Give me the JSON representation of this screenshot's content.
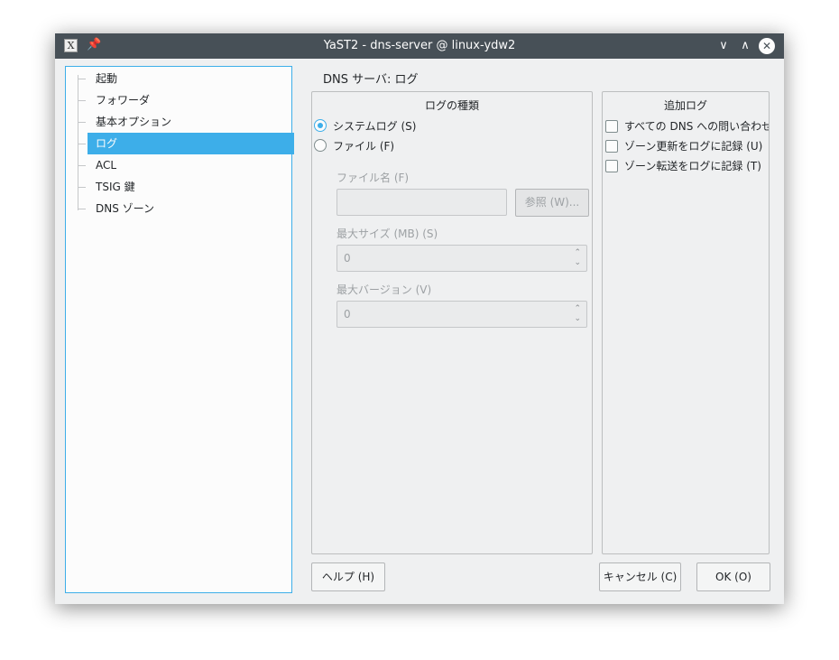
{
  "window": {
    "title": "YaST2 - dns-server @ linux-ydw2",
    "app_icon_glyph": "X",
    "pin_glyph": "📌",
    "min_glyph": "∨",
    "max_glyph": "∧",
    "close_glyph": "✕"
  },
  "tree": {
    "items": [
      {
        "label": "起動"
      },
      {
        "label": "フォワーダ"
      },
      {
        "label": "基本オプション"
      },
      {
        "label": "ログ",
        "selected": true
      },
      {
        "label": "ACL"
      },
      {
        "label": "TSIG 鍵"
      },
      {
        "label": "DNS ゾーン"
      }
    ]
  },
  "main": {
    "section_title": "DNS サーバ: ログ",
    "log_type": {
      "title": "ログの種類",
      "options": [
        {
          "label": "システムログ (S)",
          "checked": true
        },
        {
          "label": "ファイル (F)",
          "checked": false
        }
      ],
      "file_name_label": "ファイル名 (F)",
      "file_name_value": "",
      "browse_label": "参照 (W)...",
      "max_size_label": "最大サイズ (MB) (S)",
      "max_size_value": "0",
      "max_versions_label": "最大バージョン (V)",
      "max_versions_value": "0",
      "spin_up": "⌃",
      "spin_down": "⌄"
    },
    "extra_log": {
      "title": "追加ログ",
      "options": [
        {
          "label": "すべての DNS への問い合わせ",
          "checked": false
        },
        {
          "label": "ゾーン更新をログに記録 (U)",
          "checked": false
        },
        {
          "label": "ゾーン転送をログに記録 (T)",
          "checked": false
        }
      ]
    }
  },
  "buttons": {
    "help": "ヘルプ (H)",
    "cancel": "キャンセル (C)",
    "ok": "OK (O)"
  },
  "colors": {
    "accent": "#3daee9",
    "titlebar": "#475057",
    "background": "#eff0f1"
  }
}
